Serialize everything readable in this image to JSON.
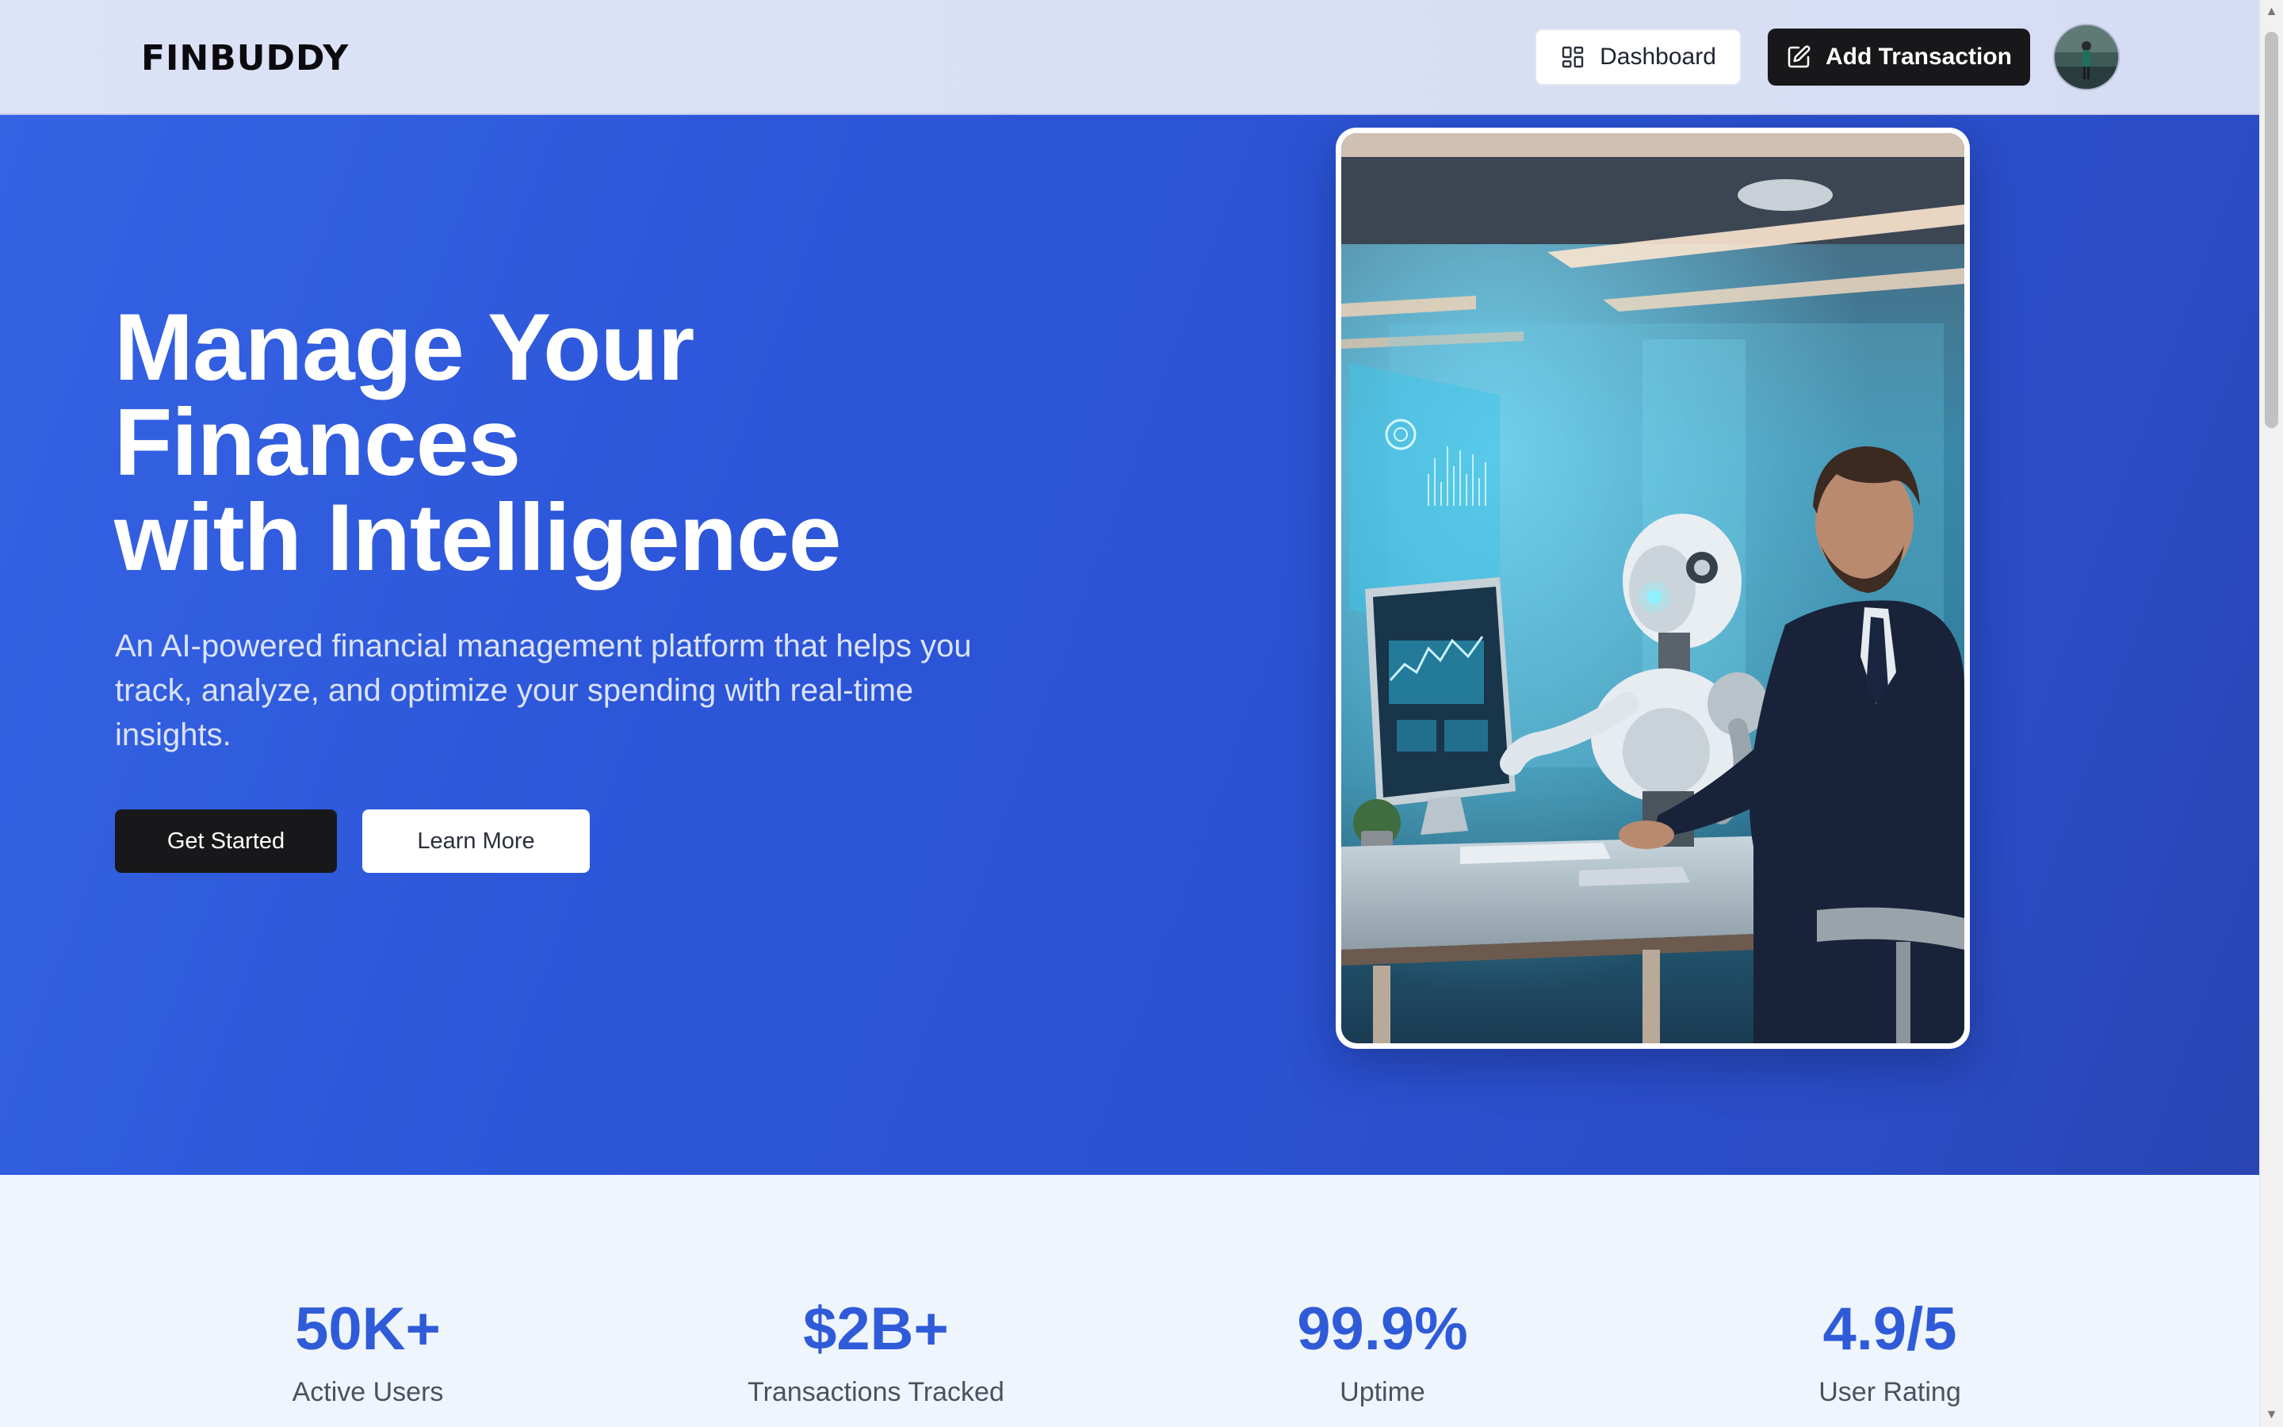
{
  "header": {
    "brand": "FINBUDDY",
    "dashboard_label": "Dashboard",
    "add_transaction_label": "Add Transaction"
  },
  "hero": {
    "title_line1": "Manage Your",
    "title_line2": "Finances",
    "title_line3": "with Intelligence",
    "subtitle": "An AI-powered financial management platform that helps you track, analyze, and optimize your spending with real-time insights.",
    "get_started_label": "Get Started",
    "learn_more_label": "Learn More"
  },
  "stats": [
    {
      "value": "50K+",
      "label": "Active Users"
    },
    {
      "value": "$2B+",
      "label": "Transactions Tracked"
    },
    {
      "value": "99.9%",
      "label": "Uptime"
    },
    {
      "value": "4.9/5",
      "label": "User Rating"
    }
  ],
  "colors": {
    "hero_blue": "#2c55d8",
    "accent_blue": "#2f5bd9",
    "dark_button": "#18181b",
    "page_background": "#eff5fd"
  },
  "icons": {
    "dashboard": "layout-grid-icon",
    "add_transaction": "pencil-square-icon"
  }
}
